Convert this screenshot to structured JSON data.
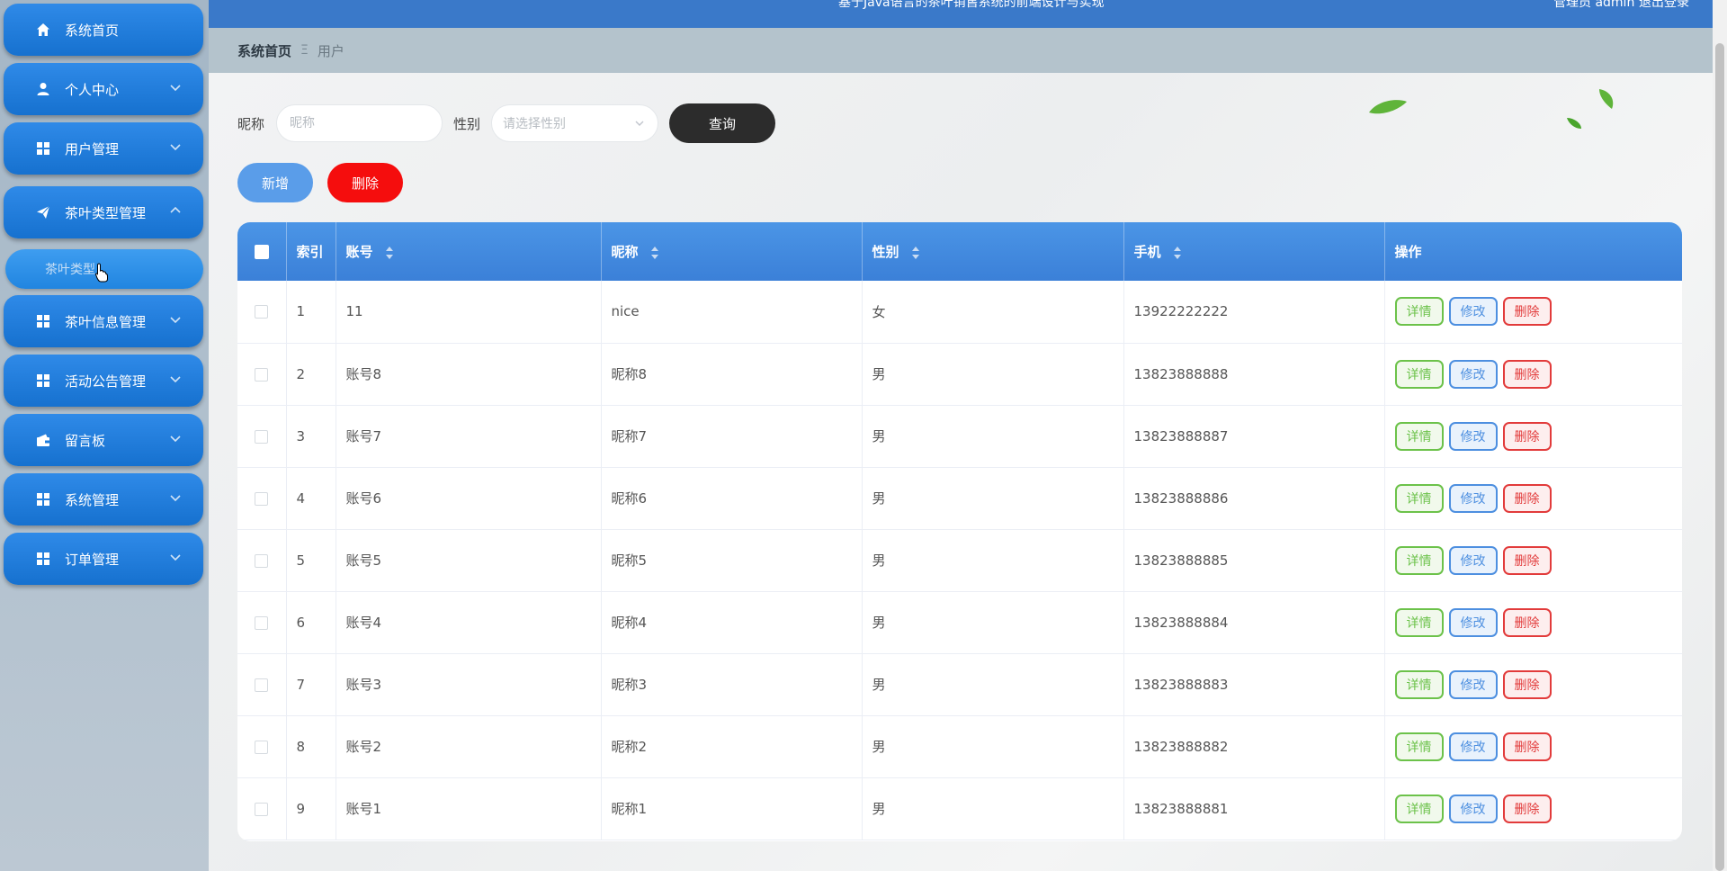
{
  "header": {
    "title": "基于Java语言的茶叶销售系统的前端设计与实现",
    "admin_label": "管理员 admin",
    "logout_label": "退出登录"
  },
  "sidebar": {
    "items": [
      {
        "label": "系统首页",
        "icon": "home-icon"
      },
      {
        "label": "个人中心",
        "icon": "user-icon"
      },
      {
        "label": "用户管理",
        "icon": "grid-icon"
      },
      {
        "label": "茶叶类型管理",
        "icon": "send-icon"
      },
      {
        "label": "茶叶信息管理",
        "icon": "grid-icon"
      },
      {
        "label": "活动公告管理",
        "icon": "grid-icon"
      },
      {
        "label": "留言板",
        "icon": "wallet-icon"
      },
      {
        "label": "系统管理",
        "icon": "grid-icon"
      },
      {
        "label": "订单管理",
        "icon": "grid-icon"
      }
    ],
    "sub_item": {
      "label": "茶叶类型"
    }
  },
  "breadcrumb": {
    "home": "系统首页",
    "separator": "Ξ",
    "current": "用户"
  },
  "search": {
    "nickname_label": "昵称",
    "nickname_placeholder": "昵称",
    "gender_label": "性别",
    "gender_placeholder": "请选择性别",
    "query_label": "查询"
  },
  "actions": {
    "add_label": "新增",
    "delete_label": "删除"
  },
  "table": {
    "columns": [
      "索引",
      "账号",
      "昵称",
      "性别",
      "手机",
      "操作"
    ],
    "row_actions": {
      "detail": "详情",
      "edit": "修改",
      "delete": "删除"
    },
    "rows": [
      {
        "index": "1",
        "account": "11",
        "nickname": "nice",
        "gender": "女",
        "phone": "13922222222"
      },
      {
        "index": "2",
        "account": "账号8",
        "nickname": "昵称8",
        "gender": "男",
        "phone": "13823888888"
      },
      {
        "index": "3",
        "account": "账号7",
        "nickname": "昵称7",
        "gender": "男",
        "phone": "13823888887"
      },
      {
        "index": "4",
        "account": "账号6",
        "nickname": "昵称6",
        "gender": "男",
        "phone": "13823888886"
      },
      {
        "index": "5",
        "account": "账号5",
        "nickname": "昵称5",
        "gender": "男",
        "phone": "13823888885"
      },
      {
        "index": "6",
        "account": "账号4",
        "nickname": "昵称4",
        "gender": "男",
        "phone": "13823888884"
      },
      {
        "index": "7",
        "account": "账号3",
        "nickname": "昵称3",
        "gender": "男",
        "phone": "13823888883"
      },
      {
        "index": "8",
        "account": "账号2",
        "nickname": "昵称2",
        "gender": "男",
        "phone": "13823888882"
      },
      {
        "index": "9",
        "account": "账号1",
        "nickname": "昵称1",
        "gender": "男",
        "phone": "13823888881"
      }
    ]
  },
  "colors": {
    "menu_blue": "#1f7ddc",
    "header_blue": "#3a79c9",
    "detail_green": "#6cc24a",
    "edit_blue": "#4d8fe0",
    "delete_red": "#e23b3b",
    "delete_button_red": "#f50d0d"
  }
}
